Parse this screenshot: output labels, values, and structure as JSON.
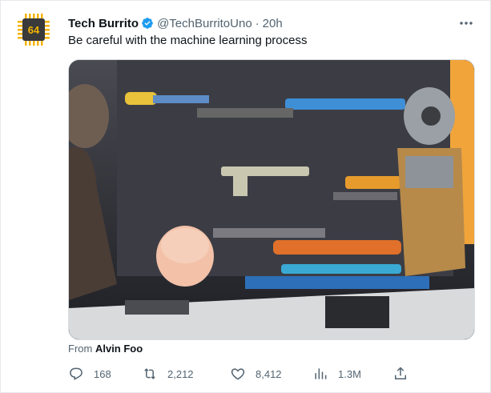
{
  "author": {
    "name": "Tech Burrito",
    "handle": "@TechBurritoUno",
    "separator": "·",
    "time": "20h",
    "avatar_text": "64"
  },
  "tweet": {
    "text": "Be careful with the machine learning process"
  },
  "attribution": {
    "prefix": "From",
    "source": "Alvin Foo"
  },
  "actions": {
    "replies": "168",
    "retweets": "2,212",
    "likes": "8,412",
    "views": "1.3M"
  },
  "icons": [
    "verified-badge-icon",
    "more-icon",
    "reply-icon",
    "retweet-icon",
    "like-icon",
    "views-icon",
    "share-icon"
  ],
  "colors": {
    "verified": "#1d9bf0",
    "muted": "#536471",
    "avatar_chip": "#3a3a3a",
    "avatar_text": "#f5b400"
  }
}
